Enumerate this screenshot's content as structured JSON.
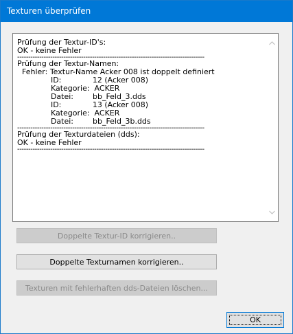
{
  "window": {
    "title": "Texturen überprüfen"
  },
  "report": {
    "lines": [
      "Prüfung der Textur-ID's:",
      "OK - keine Fehler",
      "-------------------------------------------------------------------------------------",
      "Prüfung der Textur-Namen:",
      "  Fehler: Textur-Name Acker 008 ist doppelt definiert",
      "              ID:             12 (Acker 008)",
      "              Kategorie:  ACKER",
      "              Datei:        bb_Feld_3.dds",
      "              ID:             13 (Acker 008)",
      "              Kategorie:  ACKER",
      "              Datei:        bb_Feld_3b.dds",
      "-------------------------------------------------------------------------------------",
      "Prüfung der Texturdateien (dds):",
      "OK - keine Fehler",
      "-------------------------------------------------------------------------------------"
    ]
  },
  "buttons": {
    "fix_ids": "Doppelte Textur-ID korrigieren..",
    "fix_names": "Doppelte Texturnamen korrigieren..",
    "delete_bad": "Texturen mit fehlerhaften dds-Dateien löschen...",
    "ok": "OK"
  },
  "icons": {
    "scroll_up": "chevron-up-icon",
    "scroll_down": "chevron-down-icon"
  }
}
